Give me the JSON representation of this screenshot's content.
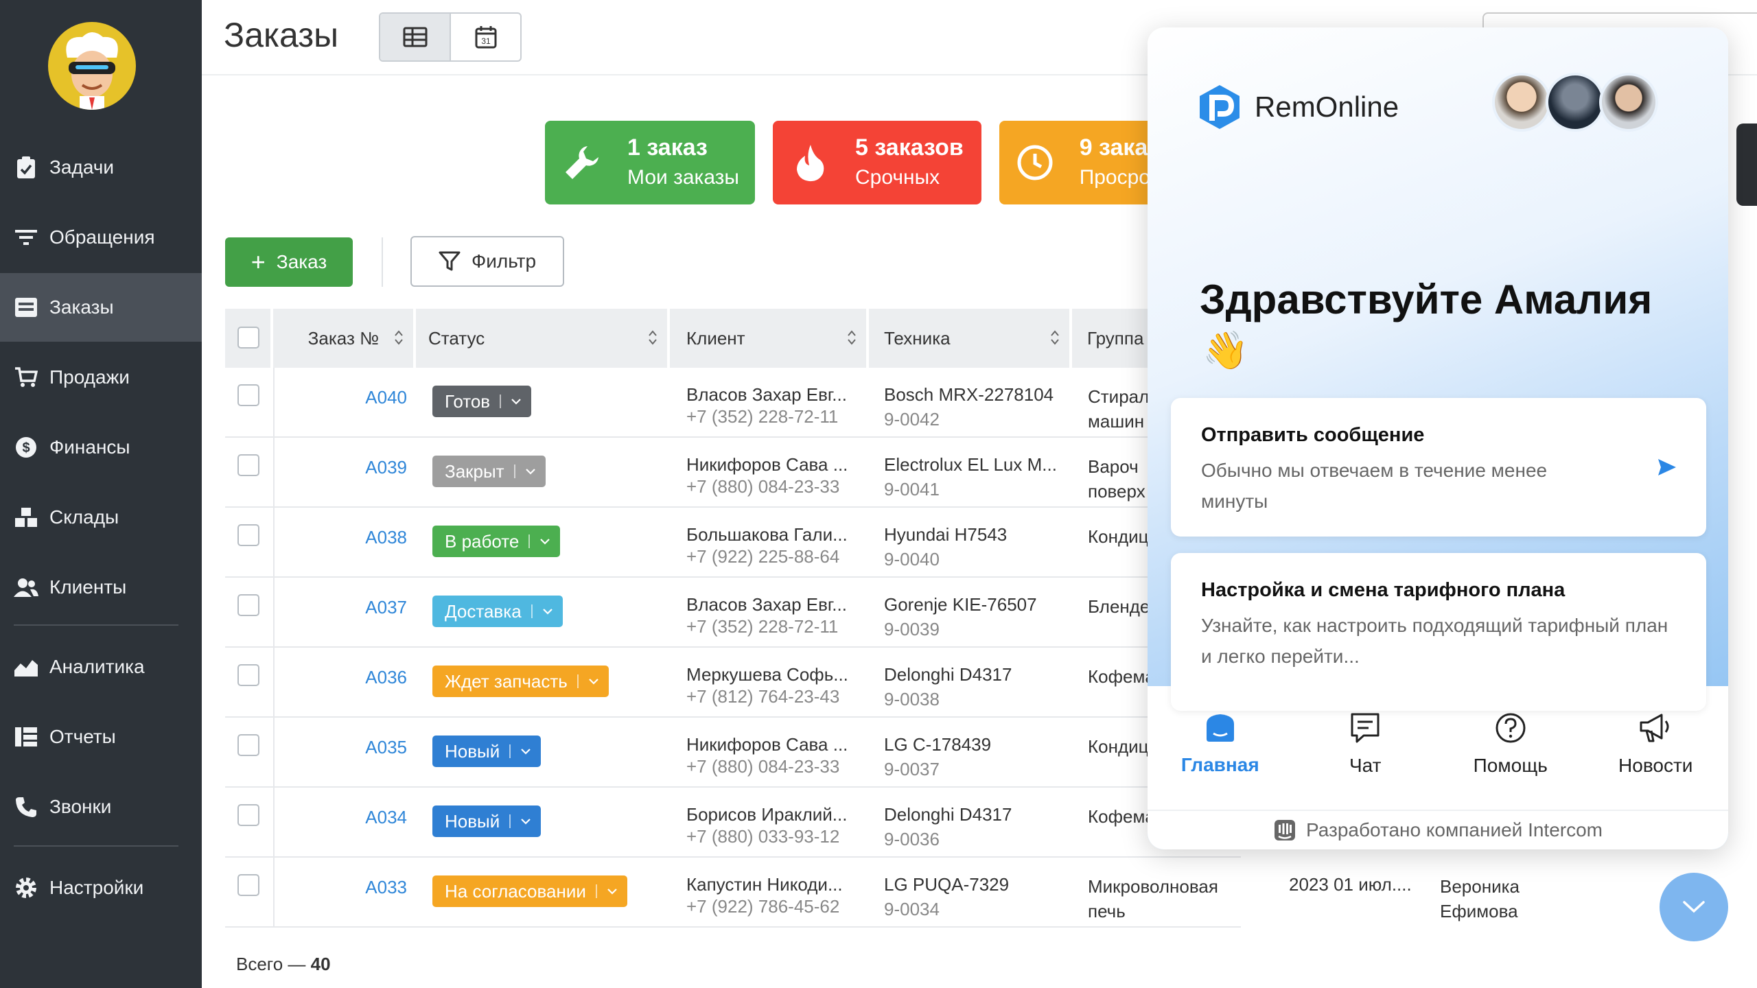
{
  "sidebar": {
    "items": [
      {
        "label": "Задачи",
        "icon": "clipboard-check-icon"
      },
      {
        "label": "Обращения",
        "icon": "filter-lines-icon"
      },
      {
        "label": "Заказы",
        "icon": "orders-list-icon",
        "active": true
      },
      {
        "label": "Продажи",
        "icon": "cart-icon"
      },
      {
        "label": "Финансы",
        "icon": "dollar-circle-icon"
      },
      {
        "label": "Склады",
        "icon": "boxes-icon"
      },
      {
        "label": "Клиенты",
        "icon": "users-icon"
      },
      {
        "label": "Аналитика",
        "icon": "area-chart-icon"
      },
      {
        "label": "Отчеты",
        "icon": "table-report-icon"
      },
      {
        "label": "Звонки",
        "icon": "phone-icon"
      },
      {
        "label": "Настройки",
        "icon": "gear-icon"
      }
    ]
  },
  "header": {
    "title": "Заказы"
  },
  "stats": [
    {
      "big": "1 заказ",
      "small": "Мои заказы",
      "color": "#4caf50",
      "icon": "wrench-icon"
    },
    {
      "big": "5 заказов",
      "small": "Срочных",
      "color": "#f44336",
      "icon": "flame-icon"
    },
    {
      "big": "9 зака",
      "small": "Просро",
      "color": "#f5a623",
      "icon": "clock-icon"
    }
  ],
  "toolbar": {
    "add_label": "Заказ",
    "filter_label": "Фильтр"
  },
  "table": {
    "columns": [
      "Заказ №",
      "Статус",
      "Клиент",
      "Техника",
      "Группа"
    ],
    "rows": [
      {
        "no": "A040",
        "status": "Готов",
        "status_color": "#5f6368",
        "client": "Власов Захар Евг...",
        "phone": "+7 (352) 228-72-11",
        "tech": "Bosch MRX-2278104",
        "tech_id": "9-0042",
        "group": "Стирал\nмашин"
      },
      {
        "no": "A039",
        "status": "Закрыт",
        "status_color": "#9e9e9e",
        "client": "Никифоров Сава ...",
        "phone": "+7 (880) 084-23-33",
        "tech": "Electrolux EL Lux M...",
        "tech_id": "9-0041",
        "group": "Вароч\nповерх"
      },
      {
        "no": "A038",
        "status": "В работе",
        "status_color": "#4caf50",
        "client": "Большакова Гали...",
        "phone": "+7 (922) 225-88-64",
        "tech": "Hyundai H7543",
        "tech_id": "9-0040",
        "group": "Кондиц"
      },
      {
        "no": "A037",
        "status": "Доставка",
        "status_color": "#4fb8e0",
        "client": "Власов Захар Евг...",
        "phone": "+7 (352) 228-72-11",
        "tech": "Gorenje KIE-76507",
        "tech_id": "9-0039",
        "group": "Бленде"
      },
      {
        "no": "A036",
        "status": "Ждет запчасть",
        "status_color": "#f5a623",
        "client": "Меркушева Софь...",
        "phone": "+7 (812) 764-23-43",
        "tech": "Delonghi D4317",
        "tech_id": "9-0038",
        "group": "Кофема"
      },
      {
        "no": "A035",
        "status": "Новый",
        "status_color": "#2f7fd3",
        "client": "Никифоров Сава ...",
        "phone": "+7 (880) 084-23-33",
        "tech": "LG C-178439",
        "tech_id": "9-0037",
        "group": "Кондиц"
      },
      {
        "no": "A034",
        "status": "Новый",
        "status_color": "#2f7fd3",
        "client": "Борисов Ираклий...",
        "phone": "+7 (880) 033-93-12",
        "tech": "Delonghi D4317",
        "tech_id": "9-0036",
        "group": "Кофема"
      },
      {
        "no": "A033",
        "status": "На согласовании",
        "status_color": "#f5a623",
        "client": "Капустин Никоди...",
        "phone": "+7 (922) 786-45-62",
        "tech": "LG PUQA-7329",
        "tech_id": "9-0034",
        "group": "Микроволновая\nпечь",
        "date": "2023 01 июл....",
        "person": "Вероника\nЕфимова"
      }
    ],
    "total_label": "Всего —",
    "total_value": "40"
  },
  "widget": {
    "brand": "RemOnline",
    "greeting": "Здравствуйте Амалия",
    "wave": "👋",
    "cards": [
      {
        "title": "Отправить сообщение",
        "desc": "Обычно мы отвечаем в течение менее минуты"
      },
      {
        "title": "Настройка и смена тарифного плана",
        "desc": "Узнайте, как настроить подходящий тарифный план и легко перейти..."
      }
    ],
    "tabs": [
      {
        "label": "Главная",
        "icon": "home-icon",
        "active": true
      },
      {
        "label": "Чат",
        "icon": "chat-icon"
      },
      {
        "label": "Помощь",
        "icon": "help-icon"
      },
      {
        "label": "Новости",
        "icon": "megaphone-icon"
      }
    ],
    "credit": "Разработано компанией Intercom"
  }
}
